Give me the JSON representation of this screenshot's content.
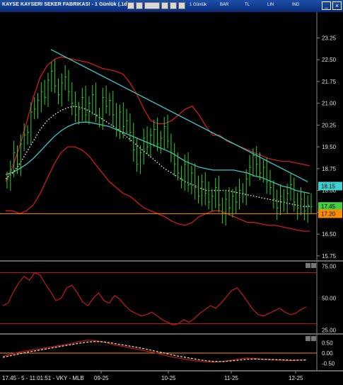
{
  "window": {
    "title": "KAYSE KAYSERI SEKER FABRIKASI - 1 Günlük (.1d)",
    "toolbar": [
      "1 Günlük",
      "BAR",
      "TL",
      "LIN",
      "IND"
    ]
  },
  "status": {
    "text": "17.45 - 5 - 11:01:51 - VKY - MLB"
  },
  "colors": {
    "price": "#2bd12b",
    "channel": "#d11a1a",
    "trend": "#3cc8c8",
    "ma_fast": "#ffffff",
    "rsi": "#c41a1a",
    "macd": "#c41a1a",
    "signal": "#f0e0c0"
  },
  "chart_data": [
    {
      "type": "candlestick",
      "pane": "price",
      "yticks": [
        "23.25",
        "22.50",
        "21.75",
        "21.00",
        "20.25",
        "19.50",
        "18.75",
        "18.00",
        "17.25",
        "16.50",
        "15.75"
      ],
      "ylim": [
        15.6,
        23.7
      ],
      "xticks": [
        "09-25",
        "10-25",
        "11-25",
        "12-25"
      ],
      "price_labels": [
        {
          "value": 18.15,
          "text": "18.15",
          "color": "#40d0d0"
        },
        {
          "value": 17.45,
          "text": "17.45",
          "color": "#40d040"
        },
        {
          "value": 17.2,
          "text": "17.20",
          "color": "#ff8c00"
        }
      ],
      "support_level": 17.2,
      "trendline": [
        [
          72,
          22.85
        ],
        [
          435,
          18.3
        ]
      ],
      "closes": [
        18.4,
        18.7,
        19.3,
        18.9,
        19.6,
        19.9,
        20.0,
        20.7,
        20.8,
        21.1,
        21.4,
        21.2,
        21.8,
        22.1,
        21.6,
        21.3,
        21.7,
        21.9,
        21.4,
        21.0,
        20.6,
        20.8,
        21.2,
        20.6,
        21.0,
        21.3,
        20.6,
        20.5,
        21.2,
        20.9,
        21.1,
        20.6,
        20.1,
        20.7,
        20.2,
        20.4,
        20.0,
        19.4,
        18.9,
        19.3,
        19.8,
        19.5,
        19.9,
        20.1,
        19.6,
        19.8,
        20.2,
        19.7,
        19.3,
        18.9,
        18.6,
        18.4,
        18.9,
        18.2,
        18.6,
        18.1,
        17.8,
        18.3,
        17.9,
        17.6,
        17.8,
        18.1,
        17.5,
        17.2,
        17.7,
        17.4,
        17.8,
        17.6,
        18.0,
        17.9,
        18.4,
        18.8,
        19.2,
        18.9,
        18.6,
        18.8,
        18.3,
        18.1,
        17.7,
        17.4,
        17.8,
        17.6,
        17.9,
        18.2,
        17.6,
        17.4,
        17.7,
        17.3,
        17.5,
        17.45
      ],
      "bands_upper": [
        18.3,
        18.8,
        19.5,
        20.3,
        21.2,
        21.9,
        22.3,
        22.5,
        22.6,
        22.55,
        22.5,
        22.45,
        22.4,
        22.3,
        22.2,
        22.15,
        22.1,
        22.0,
        21.7,
        21.3,
        20.8,
        20.4,
        20.3,
        20.3,
        20.4,
        20.6,
        20.8,
        20.9,
        20.6,
        20.2,
        19.9,
        19.9,
        19.7,
        19.6,
        19.5,
        19.4,
        19.3,
        19.2,
        19.1,
        19.05,
        19.0,
        19.0,
        18.95,
        18.9,
        18.85
      ],
      "bands_lower": [
        17.3,
        17.3,
        17.2,
        17.3,
        17.5,
        17.9,
        18.4,
        18.9,
        19.3,
        19.5,
        19.5,
        19.4,
        19.2,
        18.9,
        18.6,
        18.3,
        18.1,
        17.9,
        17.8,
        17.6,
        17.4,
        17.3,
        17.2,
        17.1,
        16.95,
        16.85,
        16.8,
        16.9,
        17.1,
        17.2,
        17.3,
        17.3,
        17.2,
        17.1,
        17.0,
        16.9,
        16.9,
        16.85,
        16.8,
        16.8,
        16.75,
        16.7,
        16.65,
        16.6,
        16.6
      ],
      "ma_slow": [
        18.55,
        18.62,
        18.75,
        18.9,
        19.1,
        19.35,
        19.6,
        19.85,
        20.05,
        20.2,
        20.3,
        20.35,
        20.35,
        20.3,
        20.25,
        20.2,
        20.1,
        20.0,
        19.9,
        19.8,
        19.7,
        19.6,
        19.5,
        19.4,
        19.3,
        19.15,
        19.0,
        18.9,
        18.8,
        18.75,
        18.7,
        18.7,
        18.7,
        18.7,
        18.65,
        18.6,
        18.5,
        18.45,
        18.35,
        18.25,
        18.15,
        18.1,
        18.0,
        17.95,
        17.9
      ],
      "ma_fast": [
        18.4,
        18.6,
        18.9,
        19.3,
        19.7,
        20.1,
        20.4,
        20.6,
        20.75,
        20.85,
        20.9,
        20.85,
        20.75,
        20.6,
        20.45,
        20.3,
        20.15,
        19.95,
        19.75,
        19.55,
        19.35,
        19.15,
        18.95,
        18.75,
        18.6,
        18.45,
        18.3,
        18.2,
        18.1,
        18.0,
        18.0,
        18.0,
        18.0,
        17.95,
        17.9,
        17.85,
        17.8,
        17.75,
        17.7,
        17.65,
        17.6,
        17.55,
        17.5,
        17.45,
        17.45
      ]
    },
    {
      "type": "line",
      "pane": "oscillator",
      "yticks": [
        "75.00",
        "50.00",
        "25.00"
      ],
      "ylim": [
        23,
        78
      ],
      "levels": [
        70,
        30
      ],
      "values": [
        44,
        46,
        55,
        62,
        67,
        64,
        70,
        68,
        61,
        55,
        48,
        50,
        58,
        60,
        54,
        47,
        44,
        50,
        54,
        48,
        46,
        52,
        49,
        44,
        40,
        38,
        36,
        37,
        39,
        36,
        33,
        31,
        29,
        30,
        33,
        31,
        34,
        38,
        41,
        44,
        42,
        46,
        51,
        56,
        58,
        53,
        47,
        41,
        37,
        36,
        38,
        40,
        42,
        39,
        37,
        38,
        41,
        43
      ]
    },
    {
      "type": "line",
      "pane": "macd",
      "yticks": [
        "0.50",
        "0.00",
        "-0.50"
      ],
      "ylim": [
        -0.75,
        0.75
      ],
      "levels": [
        0
      ],
      "series": [
        {
          "values": [
            -0.15,
            -0.05,
            0.05,
            0.12,
            0.18,
            0.25,
            0.32,
            0.38,
            0.45,
            0.55,
            0.62,
            0.6,
            0.52,
            0.42,
            0.34,
            0.26,
            0.18,
            0.1,
            0.02,
            -0.08,
            -0.18,
            -0.25,
            -0.32,
            -0.38,
            -0.42,
            -0.44,
            -0.4,
            -0.35,
            -0.28,
            -0.24,
            -0.26,
            -0.3,
            -0.33,
            -0.34,
            -0.36,
            -0.34,
            -0.33
          ]
        },
        {
          "values": [
            -0.2,
            -0.12,
            -0.03,
            0.05,
            0.12,
            0.19,
            0.26,
            0.33,
            0.4,
            0.47,
            0.53,
            0.56,
            0.54,
            0.48,
            0.41,
            0.34,
            0.27,
            0.19,
            0.1,
            0.02,
            -0.08,
            -0.16,
            -0.23,
            -0.3,
            -0.36,
            -0.4,
            -0.41,
            -0.38,
            -0.34,
            -0.3,
            -0.29,
            -0.3,
            -0.31,
            -0.32,
            -0.34,
            -0.34,
            -0.33
          ]
        }
      ]
    }
  ]
}
